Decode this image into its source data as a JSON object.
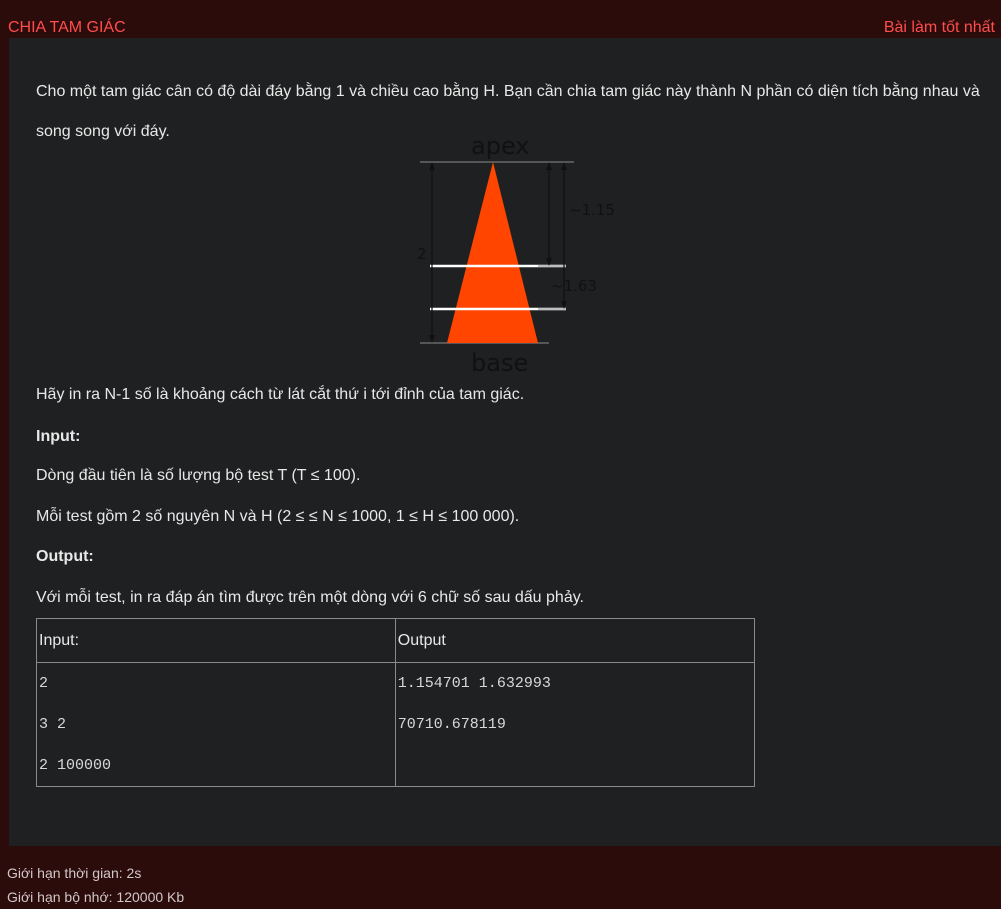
{
  "header": {
    "problem_title": "CHIA TAM GIÁC",
    "best_submissions_link": "Bài làm tốt nhất"
  },
  "statement": {
    "intro": "Cho một tam giác cân có độ dài đáy bằng 1 và chiều cao bằng H. Bạn cần chia tam giác này thành N phần có diện tích bằng nhau và song song với đáy.",
    "task": "Hãy in ra N-1 số là khoảng cách từ lát cắt thứ i tới đỉnh của tam giác.",
    "input_heading": "Input:",
    "input_line1": "Dòng đầu tiên là số lượng bộ test T (T ≤ 100).",
    "input_line2": "Mỗi test gồm 2 số nguyên N và H (2 ≤ ≤ N ≤ 1000, 1 ≤ H ≤ 100 000).",
    "output_heading": "Output:",
    "output_line1": "Với mỗi test, in ra đáp án tìm được trên một dòng với 6 chữ số sau dấu phảy."
  },
  "diagram": {
    "apex_label": "apex",
    "base_label": "base",
    "height_label": "2",
    "cut1_label": "~1.15",
    "cut2_label": "~1.63",
    "triangle_color": "#ff4500"
  },
  "sample": {
    "input_header": "Input:",
    "output_header": "Output",
    "input_lines": [
      "2",
      "3 2",
      "2 100000"
    ],
    "output_lines": [
      "1.154701 1.632993",
      "70710.678119"
    ]
  },
  "footer": {
    "time_limit": "Giới hạn thời gian: 2s",
    "memory_limit": "Giới hạn bộ nhớ: 120000 Kb"
  }
}
